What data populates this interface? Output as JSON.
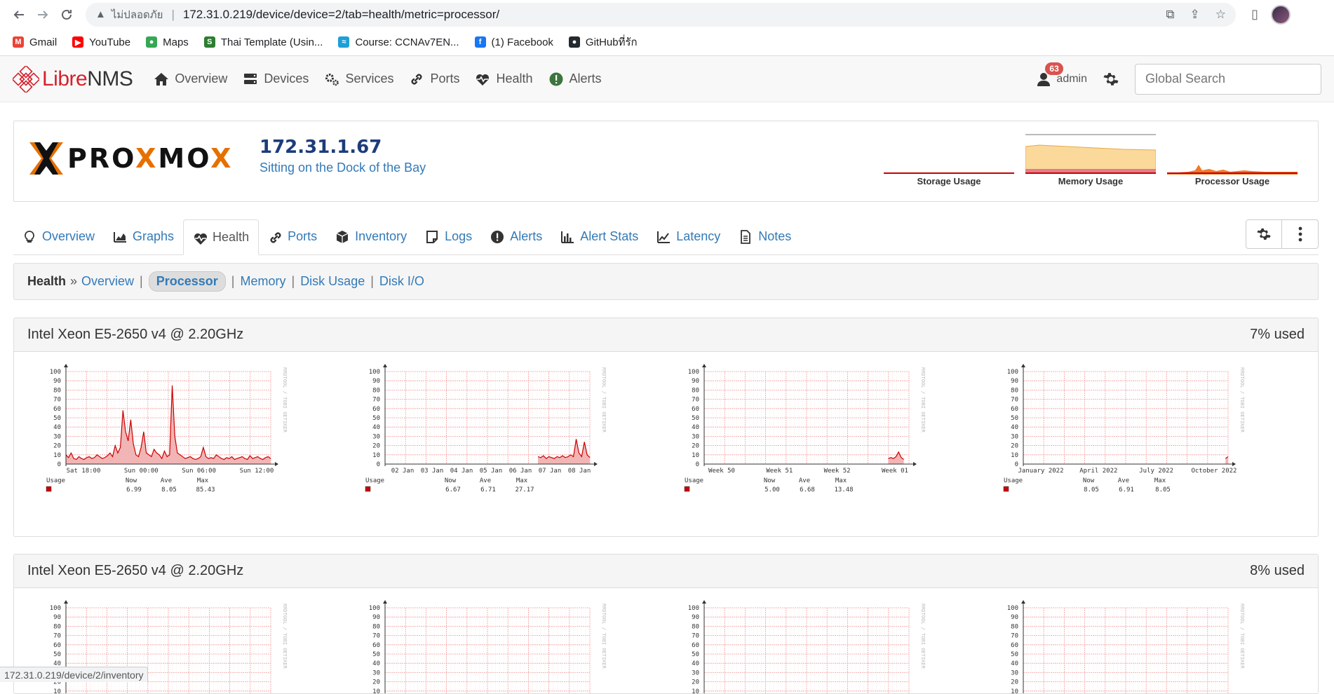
{
  "browser": {
    "insecure_label": "ไม่ปลอดภัย",
    "url": "172.31.0.219/device/device=2/tab=health/metric=processor/",
    "bookmarks": [
      {
        "label": "Gmail",
        "color": "#ea4335",
        "glyph": "M"
      },
      {
        "label": "YouTube",
        "color": "#ff0000",
        "glyph": "▶"
      },
      {
        "label": "Maps",
        "color": "#34a853",
        "glyph": "●"
      },
      {
        "label": "Thai Template (Usin...",
        "color": "#2e7d32",
        "glyph": "S"
      },
      {
        "label": "Course: CCNAv7EN...",
        "color": "#1ba0d7",
        "glyph": "≈"
      },
      {
        "label": "(1) Facebook",
        "color": "#1877f2",
        "glyph": "f"
      },
      {
        "label": "GitHubที่รัก",
        "color": "#24292e",
        "glyph": "●"
      }
    ],
    "status_url": "172.31.0.219/device/2/inventory"
  },
  "navbar": {
    "brand_libre": "Libre",
    "brand_nms": "NMS",
    "items": [
      {
        "label": "Overview",
        "icon": "home-icon"
      },
      {
        "label": "Devices",
        "icon": "server-icon"
      },
      {
        "label": "Services",
        "icon": "cogs-icon"
      },
      {
        "label": "Ports",
        "icon": "link-icon"
      },
      {
        "label": "Health",
        "icon": "heartbeat-icon"
      },
      {
        "label": "Alerts",
        "icon": "alert-circle-icon"
      }
    ],
    "alert_count": "63",
    "user": "admin",
    "search_placeholder": "Global Search"
  },
  "device": {
    "logo_text_pre": "PRO",
    "logo_text_x": "X",
    "logo_text_mo": "MO",
    "logo_text_x2": "X",
    "ip": "172.31.1.67",
    "location": "Sitting on the Dock of the Bay",
    "mini_graphs": [
      "Storage Usage",
      "Memory Usage",
      "Processor Usage"
    ]
  },
  "tabs": [
    {
      "label": "Overview",
      "icon": "lightbulb-icon",
      "active": false
    },
    {
      "label": "Graphs",
      "icon": "area-chart-icon",
      "active": false
    },
    {
      "label": "Health",
      "icon": "heartbeat-icon",
      "active": true
    },
    {
      "label": "Ports",
      "icon": "link-icon",
      "active": false
    },
    {
      "label": "Inventory",
      "icon": "cube-icon",
      "active": false
    },
    {
      "label": "Logs",
      "icon": "sticky-note-icon",
      "active": false
    },
    {
      "label": "Alerts",
      "icon": "exclamation-circle-icon",
      "active": false
    },
    {
      "label": "Alert Stats",
      "icon": "bar-chart-icon",
      "active": false
    },
    {
      "label": "Latency",
      "icon": "line-chart-icon",
      "active": false
    },
    {
      "label": "Notes",
      "icon": "file-text-icon",
      "active": false
    }
  ],
  "subnav": {
    "title": "Health",
    "raquo": "»",
    "items": [
      "Overview",
      "Processor",
      "Memory",
      "Disk Usage",
      "Disk I/O"
    ],
    "active": "Processor"
  },
  "processors": [
    {
      "name": "Intel Xeon E5-2650 v4 @ 2.20GHz",
      "used": "7% used"
    },
    {
      "name": "Intel Xeon E5-2650 v4 @ 2.20GHz",
      "used": "8% used"
    }
  ],
  "graph_common": {
    "y_ticks": [
      "100",
      "90",
      "80",
      "70",
      "60",
      "50",
      "40",
      "30",
      "20",
      "10",
      "0"
    ],
    "legend_label": "Usage",
    "col_now": "Now",
    "col_ave": "Ave",
    "col_max": "Max",
    "watermark": "RRDTOOL / TOBI OETIKER",
    "fill_color": "#f2b5b5",
    "line_color": "#cc0000"
  },
  "chart_data": [
    {
      "type": "area",
      "title": "",
      "xlabel": "",
      "ylabel": "",
      "ylim": [
        0,
        100
      ],
      "x_ticks": [
        "Sat 18:00",
        "Sun 00:00",
        "Sun 06:00",
        "Sun 12:00"
      ],
      "series": [
        {
          "name": "Usage",
          "values": [
            10,
            7,
            12,
            6,
            5,
            8,
            6,
            5,
            7,
            8,
            6,
            7,
            10,
            8,
            6,
            7,
            9,
            12,
            8,
            20,
            12,
            18,
            58,
            35,
            25,
            48,
            22,
            10,
            8,
            18,
            35,
            12,
            10,
            8,
            16,
            12,
            10,
            6,
            14,
            8,
            10,
            85,
            30,
            12,
            10,
            8,
            6,
            7,
            8,
            6,
            5,
            6,
            8,
            18,
            8,
            6,
            7,
            6,
            10,
            8,
            6,
            5,
            7,
            6,
            8,
            5,
            6,
            7,
            8,
            6,
            5,
            9,
            6,
            7,
            8,
            6,
            5,
            7,
            8,
            6
          ]
        }
      ],
      "stats": {
        "now": "6.99",
        "ave": "8.05",
        "max": "85.43"
      }
    },
    {
      "type": "area",
      "title": "",
      "xlabel": "",
      "ylabel": "",
      "ylim": [
        0,
        100
      ],
      "x_ticks": [
        "02 Jan",
        "03 Jan",
        "04 Jan",
        "05 Jan",
        "06 Jan",
        "07 Jan",
        "08 Jan"
      ],
      "series": [
        {
          "name": "Usage",
          "values": [
            null,
            null,
            null,
            null,
            null,
            null,
            null,
            null,
            null,
            null,
            null,
            null,
            null,
            null,
            null,
            null,
            null,
            null,
            null,
            null,
            null,
            null,
            null,
            null,
            null,
            null,
            null,
            null,
            null,
            null,
            null,
            null,
            null,
            null,
            null,
            null,
            null,
            null,
            null,
            null,
            null,
            null,
            null,
            null,
            null,
            null,
            null,
            null,
            null,
            null,
            null,
            null,
            null,
            null,
            null,
            null,
            8,
            7,
            9,
            6,
            8,
            7,
            6,
            8,
            7,
            9,
            7,
            8,
            10,
            8,
            27,
            12,
            8,
            24,
            10,
            7
          ]
        }
      ],
      "stats": {
        "now": "6.67",
        "ave": "6.71",
        "max": "27.17"
      }
    },
    {
      "type": "area",
      "title": "",
      "xlabel": "",
      "ylabel": "",
      "ylim": [
        0,
        100
      ],
      "x_ticks": [
        "Week 50",
        "Week 51",
        "Week 52",
        "Week 01"
      ],
      "series": [
        {
          "name": "Usage",
          "values": [
            null,
            null,
            null,
            null,
            null,
            null,
            null,
            null,
            null,
            null,
            null,
            null,
            null,
            null,
            null,
            null,
            null,
            null,
            null,
            null,
            null,
            null,
            null,
            null,
            null,
            null,
            null,
            null,
            null,
            null,
            null,
            null,
            null,
            null,
            null,
            null,
            null,
            null,
            null,
            null,
            null,
            null,
            null,
            null,
            null,
            null,
            null,
            null,
            null,
            null,
            null,
            null,
            null,
            null,
            null,
            null,
            null,
            null,
            null,
            null,
            null,
            null,
            null,
            null,
            null,
            null,
            null,
            null,
            null,
            null,
            null,
            6,
            7,
            6,
            8,
            13,
            7,
            5,
            null,
            null
          ]
        }
      ],
      "stats": {
        "now": "5.00",
        "ave": "6.68",
        "max": "13.48"
      }
    },
    {
      "type": "area",
      "title": "",
      "xlabel": "",
      "ylabel": "",
      "ylim": [
        0,
        100
      ],
      "x_ticks": [
        "January 2022",
        "April 2022",
        "July 2022",
        "October 2022"
      ],
      "series": [
        {
          "name": "Usage",
          "values": [
            null,
            null,
            null,
            null,
            null,
            null,
            null,
            null,
            null,
            null,
            null,
            null,
            null,
            null,
            null,
            null,
            null,
            null,
            null,
            null,
            null,
            null,
            null,
            null,
            null,
            null,
            null,
            null,
            null,
            null,
            null,
            null,
            null,
            null,
            null,
            null,
            null,
            null,
            null,
            null,
            null,
            null,
            null,
            null,
            null,
            null,
            null,
            null,
            null,
            null,
            null,
            null,
            null,
            null,
            null,
            null,
            null,
            null,
            null,
            null,
            null,
            null,
            null,
            null,
            null,
            null,
            null,
            null,
            null,
            null,
            null,
            null,
            null,
            null,
            null,
            null,
            null,
            null,
            6,
            8
          ]
        }
      ],
      "stats": {
        "now": "8.05",
        "ave": "6.91",
        "max": "8.05"
      }
    }
  ]
}
